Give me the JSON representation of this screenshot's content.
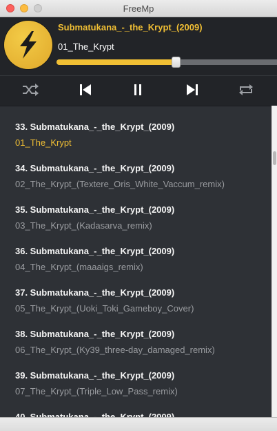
{
  "window": {
    "title": "FreeMp"
  },
  "now_playing": {
    "artist": "Submatukana_-_the_Krypt_(2009)",
    "track": "01_The_Krypt",
    "progress_percent": 54,
    "logo_icon": "lightning-bolt-icon"
  },
  "controls": [
    {
      "name": "shuffle-button",
      "icon": "shuffle-icon"
    },
    {
      "name": "previous-button",
      "icon": "skip-previous-icon"
    },
    {
      "name": "pause-button",
      "icon": "pause-icon"
    },
    {
      "name": "next-button",
      "icon": "skip-next-icon"
    },
    {
      "name": "repeat-button",
      "icon": "repeat-icon"
    }
  ],
  "colors": {
    "accent": "#f1bf34",
    "background": "#2e3136",
    "header": "#222428"
  },
  "playlist": [
    {
      "head": "33. Submatukana_-_the_Krypt_(2009)",
      "file": "01_The_Krypt",
      "active": true
    },
    {
      "head": "34. Submatukana_-_the_Krypt_(2009)",
      "file": "02_The_Krypt_(Textere_Oris_White_Vaccum_remix)",
      "active": false
    },
    {
      "head": "35. Submatukana_-_the_Krypt_(2009)",
      "file": "03_The_Krypt_(Kadasarva_remix)",
      "active": false
    },
    {
      "head": "36. Submatukana_-_the_Krypt_(2009)",
      "file": "04_The_Krypt_(maaaigs_remix)",
      "active": false
    },
    {
      "head": "37. Submatukana_-_the_Krypt_(2009)",
      "file": "05_The_Krypt_(Uoki_Toki_Gameboy_Cover)",
      "active": false
    },
    {
      "head": "38. Submatukana_-_the_Krypt_(2009)",
      "file": "06_The_Krypt_(Ky39_three-day_damaged_remix)",
      "active": false
    },
    {
      "head": "39. Submatukana_-_the_Krypt_(2009)",
      "file": "07_The_Krypt_(Triple_Low_Pass_remix)",
      "active": false
    },
    {
      "head": "40. Submatukana_-_the_Krypt_(2009)",
      "file": "",
      "active": false
    }
  ]
}
